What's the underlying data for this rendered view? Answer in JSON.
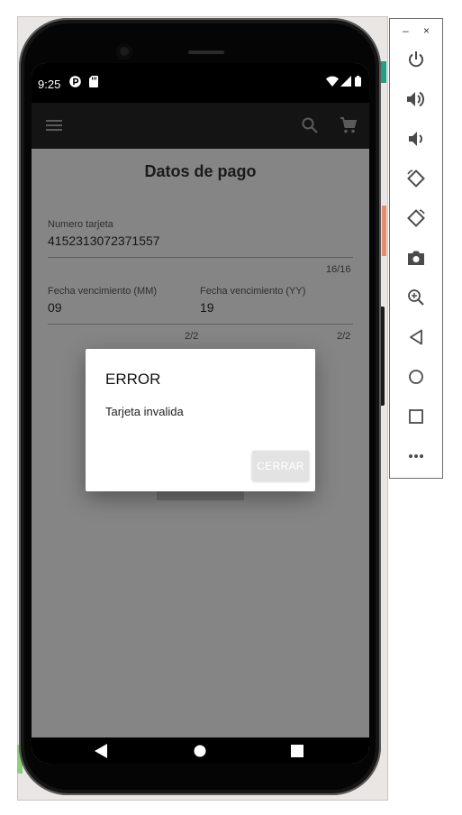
{
  "status_bar": {
    "time": "9:25"
  },
  "page": {
    "title": "Datos de pago"
  },
  "form": {
    "card_number": {
      "label": "Numero tarjeta",
      "value": "4152313072371557",
      "counter": "16/16"
    },
    "exp_month": {
      "label": "Fecha vencimiento (MM)",
      "value": "09",
      "counter": "2/2"
    },
    "exp_year": {
      "label": "Fecha vencimiento (YY)",
      "value": "19",
      "counter": "2/2"
    }
  },
  "dialog": {
    "title": "ERROR",
    "message": "Tarjeta invalida",
    "button_label": "CERRAR"
  },
  "emulator_panel": {
    "minimize": "–",
    "close": "×",
    "tools": [
      "power-icon",
      "volume-up-icon",
      "volume-down-icon",
      "rotate-left-icon",
      "rotate-right-icon",
      "camera-icon",
      "zoom-icon",
      "back-icon",
      "home-icon",
      "overview-icon",
      "more-icon"
    ]
  },
  "colors": {
    "appbar": "#141414",
    "scrim_screen": "#858585",
    "dialog": "#ffffff",
    "icon": "#4a4a4a"
  }
}
